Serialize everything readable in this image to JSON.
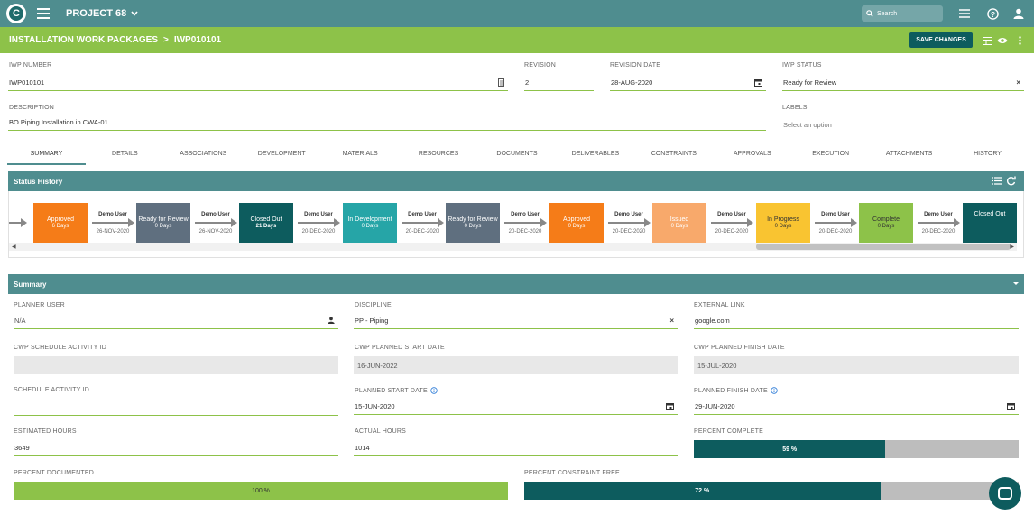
{
  "topbar": {
    "project_title": "PROJECT 68",
    "search_placeholder": "Search"
  },
  "header": {
    "crumb_parent": "INSTALLATION WORK PACKAGES",
    "crumb_sep": ">",
    "crumb_current": "IWP010101",
    "save_label": "SAVE CHANGES"
  },
  "form": {
    "iwp_number_label": "IWP NUMBER",
    "iwp_number": "IWP010101",
    "revision_label": "REVISION",
    "revision": "2",
    "revision_date_label": "REVISION DATE",
    "revision_date": "28-AUG-2020",
    "iwp_status_label": "IWP STATUS",
    "iwp_status": "Ready for Review",
    "description_label": "DESCRIPTION",
    "description": "BO Piping Installation in CWA-01",
    "labels_label": "LABELS",
    "labels_placeholder": "Select an option"
  },
  "tabs": [
    "SUMMARY",
    "DETAILS",
    "ASSOCIATIONS",
    "DEVELOPMENT",
    "MATERIALS",
    "RESOURCES",
    "DOCUMENTS",
    "DELIVERABLES",
    "CONSTRAINTS",
    "APPROVALS",
    "EXECUTION",
    "ATTACHMENTS",
    "HISTORY"
  ],
  "status_history": {
    "title": "Status History",
    "partial_date": "020",
    "steps": [
      {
        "name": "Approved",
        "days": "6 Days",
        "color": "#f57c18",
        "user": "Demo User",
        "date": "26-NOV-2020"
      },
      {
        "name": "Ready for Review",
        "days": "0 Days",
        "color": "#5f6f7f",
        "user": "Demo User",
        "date": "26-NOV-2020"
      },
      {
        "name": "Closed Out",
        "days": "21 Days",
        "color": "#0d5c5e",
        "user": "Demo User",
        "date": "20-DEC-2020"
      },
      {
        "name": "In Development",
        "days": "0 Days",
        "color": "#26a5a7",
        "user": "Demo User",
        "date": "20-DEC-2020"
      },
      {
        "name": "Ready for Review",
        "days": "0 Days",
        "color": "#5f6f7f",
        "user": "Demo User",
        "date": "20-DEC-2020"
      },
      {
        "name": "Approved",
        "days": "0 Days",
        "color": "#f57c18",
        "user": "Demo User",
        "date": "20-DEC-2020"
      },
      {
        "name": "Issued",
        "days": "0 Days",
        "color": "#f8a96b",
        "user": "Demo User",
        "date": "20-DEC-2020"
      },
      {
        "name": "In Progress",
        "days": "0 Days",
        "color": "#f9c431",
        "user": "Demo User",
        "date": "20-DEC-2020"
      },
      {
        "name": "Complete",
        "days": "0 Days",
        "color": "#8dc249",
        "user": "Demo User",
        "date": "20-DEC-2020"
      },
      {
        "name": "Closed Out",
        "days": "",
        "color": "#0d5c5e",
        "user": "",
        "date": ""
      }
    ]
  },
  "summary": {
    "title": "Summary",
    "planner_user_label": "PLANNER USER",
    "planner_user": "N/A",
    "discipline_label": "DISCIPLINE",
    "discipline": "PP - Piping",
    "external_link_label": "EXTERNAL LINK",
    "external_link": "google.com",
    "cwp_activity_label": "CWP SCHEDULE ACTIVITY ID",
    "cwp_activity": "",
    "cwp_start_label": "CWP PLANNED START DATE",
    "cwp_start": "16-JUN-2022",
    "cwp_finish_label": "CWP PLANNED FINISH DATE",
    "cwp_finish": "15-JUL-2020",
    "schedule_activity_label": "SCHEDULE ACTIVITY ID",
    "schedule_activity": "",
    "planned_start_label": "PLANNED START DATE",
    "planned_start": "15-JUN-2020",
    "planned_finish_label": "PLANNED FINISH DATE",
    "planned_finish": "29-JUN-2020",
    "est_hours_label": "ESTIMATED HOURS",
    "est_hours": "3649",
    "actual_hours_label": "ACTUAL HOURS",
    "actual_hours": "1014",
    "pct_complete_label": "PERCENT COMPLETE",
    "pct_complete": 59,
    "pct_complete_text": "59 %",
    "pct_documented_label": "PERCENT DOCUMENTED",
    "pct_documented": 100,
    "pct_documented_text": "100 %",
    "pct_constraint_label": "PERCENT CONSTRAINT FREE",
    "pct_constraint": 72,
    "pct_constraint_text": "72 %"
  },
  "colors": {
    "teal": "#4f8d8f",
    "green": "#8dc249",
    "dark_teal": "#0d5c5e"
  }
}
